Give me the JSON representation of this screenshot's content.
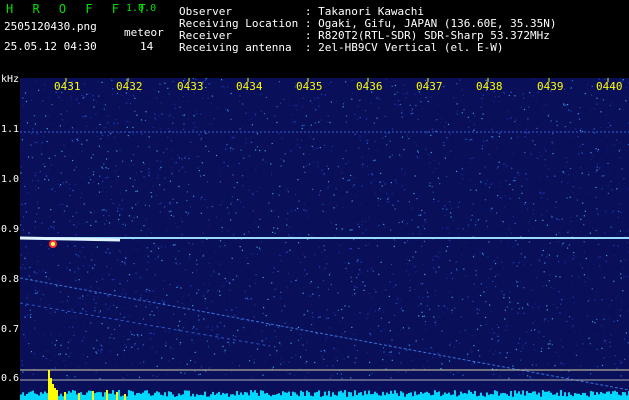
{
  "app": {
    "brand": "H R O F F T",
    "version": "1.0.0"
  },
  "file": {
    "name": "2505120430.png",
    "datetime": "25.05.12 04:30"
  },
  "meteor": {
    "label": "meteor",
    "count": "14"
  },
  "info": [
    {
      "label": "Observer           ",
      "value": ": Takanori Kawachi"
    },
    {
      "label": "Receiving Location ",
      "value": ": Ogaki, Gifu, JAPAN (136.60E, 35.35N)"
    },
    {
      "label": "Receiver           ",
      "value": ": R820T2(RTL-SDR) SDR-Sharp 53.372MHz"
    },
    {
      "label": "Receiving antenna  ",
      "value": ": 2el-HB9CV Vertical (el. E-W)"
    }
  ],
  "axis": {
    "unit": "kHz",
    "time_ticks": [
      "0431",
      "0432",
      "0433",
      "0434",
      "0435",
      "0436",
      "0437",
      "0438",
      "0439",
      "0440"
    ],
    "freq_ticks": [
      "1.1",
      "1.0",
      "0.9",
      "0.8",
      "0.7",
      "0.6"
    ]
  },
  "colors": {
    "background": "#000000",
    "spectrogram_bg": "#0a0f5a",
    "text_yellow": "#ffff00",
    "text_green": "#00e000",
    "signal": "#9ad8ff",
    "echo": "#ff3030"
  }
}
